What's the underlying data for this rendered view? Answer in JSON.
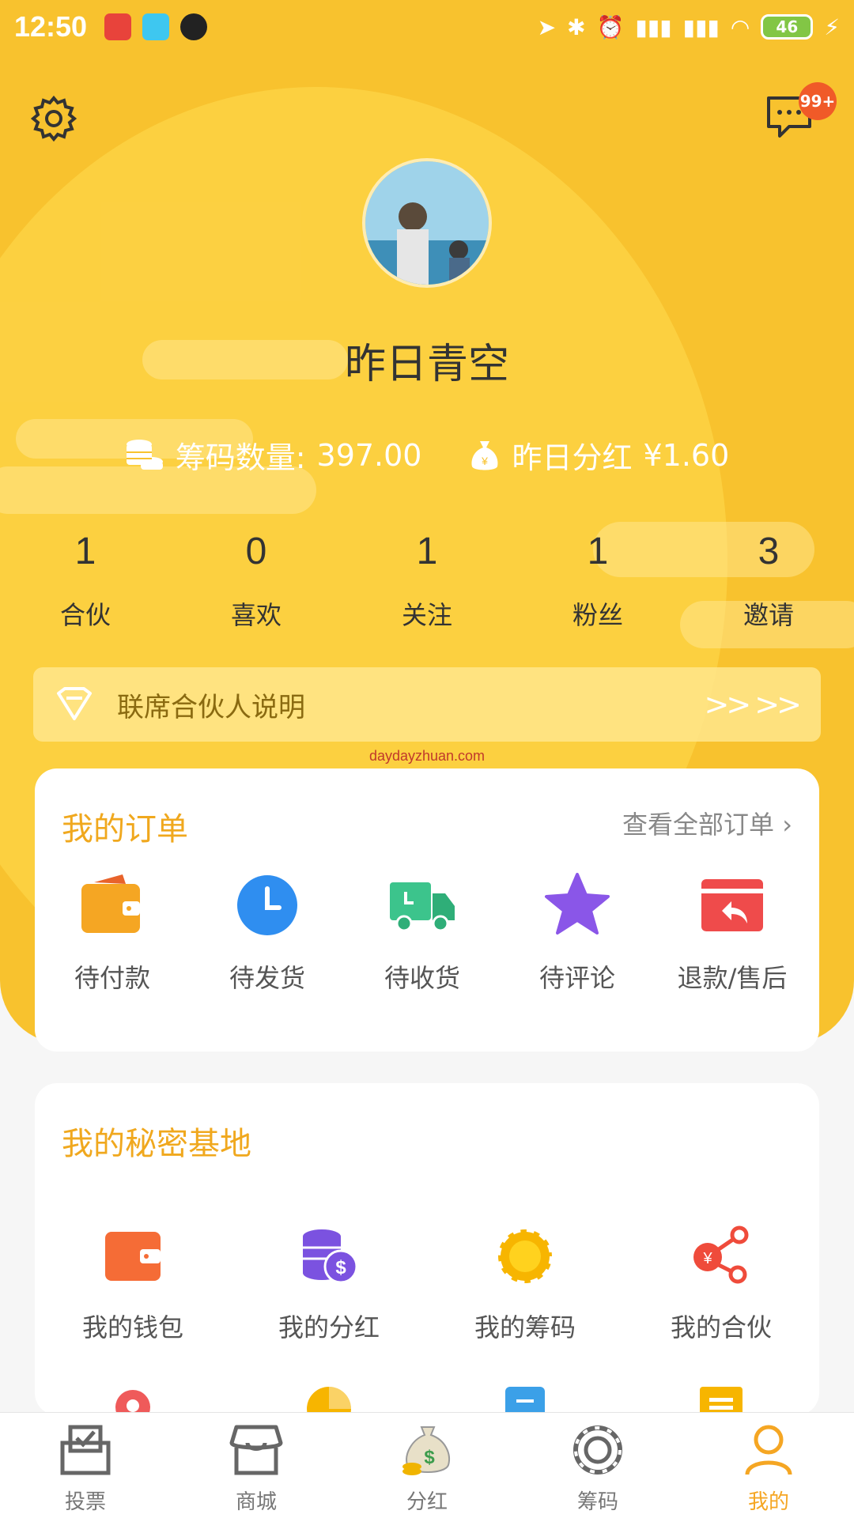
{
  "status_bar": {
    "time": "12:50",
    "battery": "46"
  },
  "header": {
    "message_badge": "99+"
  },
  "profile": {
    "username": "昨日青空",
    "chips_label": "筹码数量:",
    "chips_value": "397.00",
    "dividend_label": "昨日分红",
    "dividend_value": "¥1.60"
  },
  "stats": [
    {
      "value": "1",
      "label": "合伙"
    },
    {
      "value": "0",
      "label": "喜欢"
    },
    {
      "value": "1",
      "label": "关注"
    },
    {
      "value": "1",
      "label": "粉丝"
    },
    {
      "value": "3",
      "label": "邀请"
    }
  ],
  "partner_bar": {
    "label": "联席合伙人说明",
    "arrows": ">> >>"
  },
  "watermark": "daydayzhuan.com",
  "orders": {
    "title": "我的订单",
    "view_all": "查看全部订单 ›",
    "items": [
      {
        "label": "待付款",
        "icon": "wallet-icon"
      },
      {
        "label": "待发货",
        "icon": "clock-icon"
      },
      {
        "label": "待收货",
        "icon": "truck-icon"
      },
      {
        "label": "待评论",
        "icon": "star-icon"
      },
      {
        "label": "退款/售后",
        "icon": "refund-icon"
      }
    ]
  },
  "secret_base": {
    "title": "我的秘密基地",
    "items": [
      {
        "label": "我的钱包",
        "icon": "wallet-icon"
      },
      {
        "label": "我的分红",
        "icon": "coins-dollar-icon"
      },
      {
        "label": "我的筹码",
        "icon": "chip-icon"
      },
      {
        "label": "我的合伙",
        "icon": "share-icon"
      }
    ]
  },
  "bottom_nav": [
    {
      "label": "投票",
      "icon": "vote-icon",
      "active": false
    },
    {
      "label": "商城",
      "icon": "store-icon",
      "active": false
    },
    {
      "label": "分红",
      "icon": "money-bag-icon",
      "active": false
    },
    {
      "label": "筹码",
      "icon": "chip-icon",
      "active": false
    },
    {
      "label": "我的",
      "icon": "person-icon",
      "active": true
    }
  ],
  "colors": {
    "brand_yellow": "#f8c22e",
    "title_orange": "#f0a81e",
    "active_nav": "#f5a623"
  }
}
